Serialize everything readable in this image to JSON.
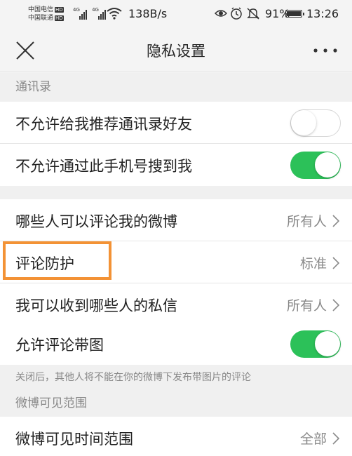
{
  "status_bar": {
    "carrier_1": "中国电信",
    "carrier_2": "中国联通",
    "hd_badge": "HD",
    "network_type": "4G",
    "speed": "138B/s",
    "battery_percent": "91%",
    "battery_level": 0.91,
    "time": "13:26",
    "icons": [
      "eye-icon",
      "alarm-icon",
      "mute-icon"
    ]
  },
  "nav": {
    "title": "隐私设置",
    "close_icon": "close-icon",
    "more_icon": "more-icon"
  },
  "sections": {
    "contacts_header": "通讯录",
    "weibo_visibility_header": "微博可见范围"
  },
  "rows": {
    "no_recommend_contacts": {
      "label": "不允许给我推荐通讯录好友",
      "enabled": false
    },
    "no_search_by_phone": {
      "label": "不允许通过此手机号搜到我",
      "enabled": true
    },
    "who_can_comment": {
      "label": "哪些人可以评论我的微博",
      "value": "所有人"
    },
    "comment_protection": {
      "label": "评论防护",
      "value": "标准"
    },
    "who_can_message": {
      "label": "我可以收到哪些人的私信",
      "value": "所有人"
    },
    "allow_comment_images": {
      "label": "允许评论带图",
      "enabled": true
    },
    "visible_time_range": {
      "label": "微博可见时间范围",
      "value": "全部"
    }
  },
  "notes": {
    "comment_images_note": "关闭后，其他人将不能在你的微博下发布带图片的评论"
  },
  "colors": {
    "toggle_on": "#2cc159",
    "highlight": "#f39235",
    "section_bg": "#f0f0f0"
  }
}
